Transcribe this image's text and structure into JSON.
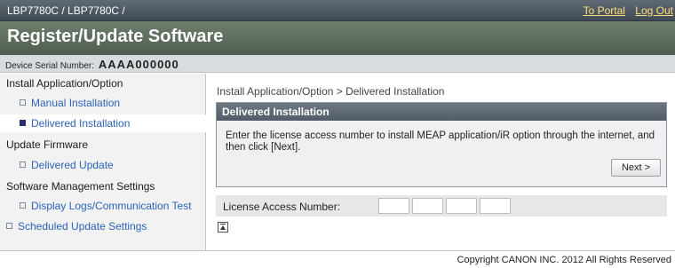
{
  "header": {
    "device_path": "LBP7780C / LBP7780C /",
    "to_portal": "To Portal",
    "log_out": "Log Out"
  },
  "title": "Register/Update Software",
  "serial": {
    "label": "Device Serial Number:",
    "value": "AAAA000000"
  },
  "sidebar": {
    "sections": [
      {
        "label": "Install Application/Option"
      },
      {
        "label": "Update Firmware"
      },
      {
        "label": "Software Management Settings"
      }
    ],
    "items": [
      {
        "label": "Manual Installation"
      },
      {
        "label": "Delivered Installation",
        "active": true
      },
      {
        "label": "Delivered Update"
      },
      {
        "label": "Display Logs/Communication Test"
      },
      {
        "label": "Scheduled Update Settings"
      }
    ]
  },
  "main": {
    "breadcrumb": "Install Application/Option > Delivered Installation",
    "panel": {
      "title": "Delivered Installation",
      "message": "Enter the license access number to install MEAP application/iR option through the internet, and then click [Next].",
      "next_label": "Next >"
    },
    "license": {
      "label": "License Access Number:",
      "fields": [
        "",
        "",
        "",
        ""
      ]
    }
  },
  "footer": {
    "copyright": "Copyright CANON INC. 2012 All Rights Reserved"
  }
}
